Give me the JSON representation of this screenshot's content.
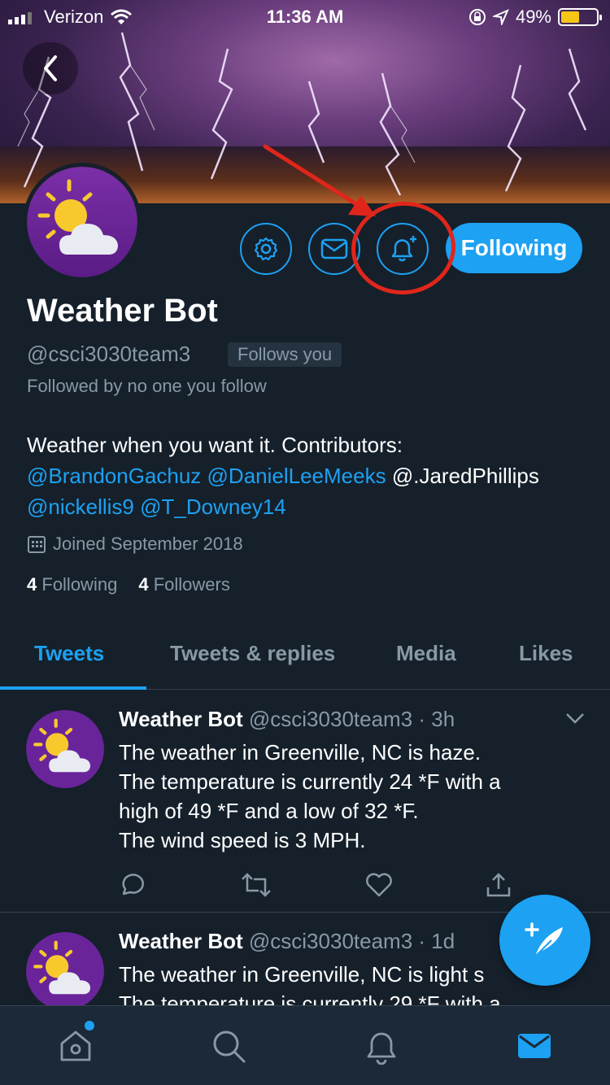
{
  "status_bar": {
    "carrier": "Verizon",
    "time": "11:36 AM",
    "battery": "49%",
    "battery_color": "#f5c518"
  },
  "profile": {
    "name": "Weather Bot",
    "handle": "@csci3030team3",
    "follows_you": "Follows you",
    "followed_by": "Followed by no one you follow",
    "bio_text": "Weather when you want it. Contributors:",
    "bio_mentions": [
      "@BrandonGachuz",
      "@DanielLeeMeeks"
    ],
    "bio_plain_mention": "@.JaredPhillips",
    "bio_mentions_2": [
      "@nickellis9",
      "@T_Downey14"
    ],
    "joined": "Joined September 2018",
    "following_count": "4",
    "following_label": "Following",
    "followers_count": "4",
    "followers_label": "Followers",
    "following_button": "Following"
  },
  "tabs": [
    {
      "label": "Tweets",
      "active": true
    },
    {
      "label": "Tweets & replies",
      "active": false
    },
    {
      "label": "Media",
      "active": false
    },
    {
      "label": "Likes",
      "active": false
    }
  ],
  "tweets": [
    {
      "name": "Weather Bot",
      "meta": "@csci3030team3 · 3h",
      "lines": [
        "The weather in Greenville, NC is haze.",
        "The temperature is currently 24 *F with a",
        "high of 49 *F and a low of 32 *F.",
        "The wind speed is 3 MPH."
      ]
    },
    {
      "name": "Weather Bot",
      "meta": "@csci3030team3 · 1d",
      "lines": [
        "The weather in Greenville, NC is light s",
        "The temperature is currently 29 *F with a"
      ]
    }
  ],
  "icons": {
    "back": "chevron-left-icon",
    "settings": "gear-icon",
    "message": "envelope-icon",
    "notify": "bell-plus-icon",
    "compose": "compose-feather-icon",
    "nav": [
      "home-icon",
      "search-icon",
      "bell-icon",
      "mail-icon"
    ]
  },
  "colors": {
    "accent": "#1da1f2",
    "background": "#15202b",
    "annotation": "#e0261b"
  }
}
